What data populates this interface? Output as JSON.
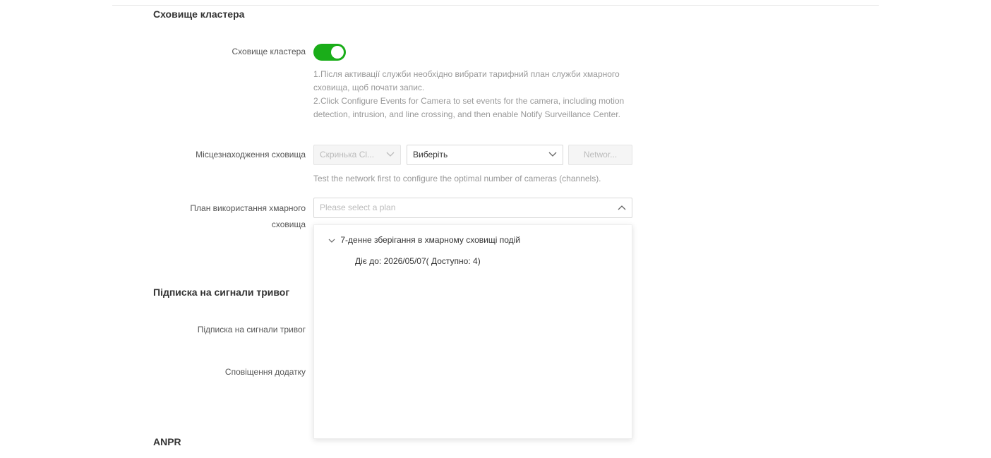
{
  "cluster_storage": {
    "section_title": "Сховище кластера",
    "toggle_label": "Сховище кластера",
    "toggle_on": true,
    "hint_line1": "1.Після активації служби необхідно вибрати тарифний план служби хмарного сховища, щоб почати запис.",
    "hint_line2": "2.Click Configure Events for Camera to set events for the camera, including motion detection, intrusion, and line crossing, and then enable Notify Surveillance Center."
  },
  "storage_location": {
    "label": "Місцезнаходження сховища",
    "select1_value": "Скринька Cl...",
    "select2_value": "Виберіть",
    "network_button": "Networ...",
    "test_note": "Test the network first to configure the optimal number of cameras (channels)."
  },
  "cloud_plan": {
    "label": "План використання хмарного сховища",
    "placeholder": "Please select a plan",
    "group_label": "7-денне зберігання в хмарному сховищі подій",
    "option_label": "Діє до: 2026/05/07( Доступно: 4)"
  },
  "alarm_subscription": {
    "section_title": "Підписка на сигнали тривог",
    "subscription_label": "Підписка на сигнали тривог",
    "app_notification_label": "Сповіщення додатку"
  },
  "anpr": {
    "section_title": "ANPR"
  },
  "colors": {
    "accent": "#1aad19"
  }
}
